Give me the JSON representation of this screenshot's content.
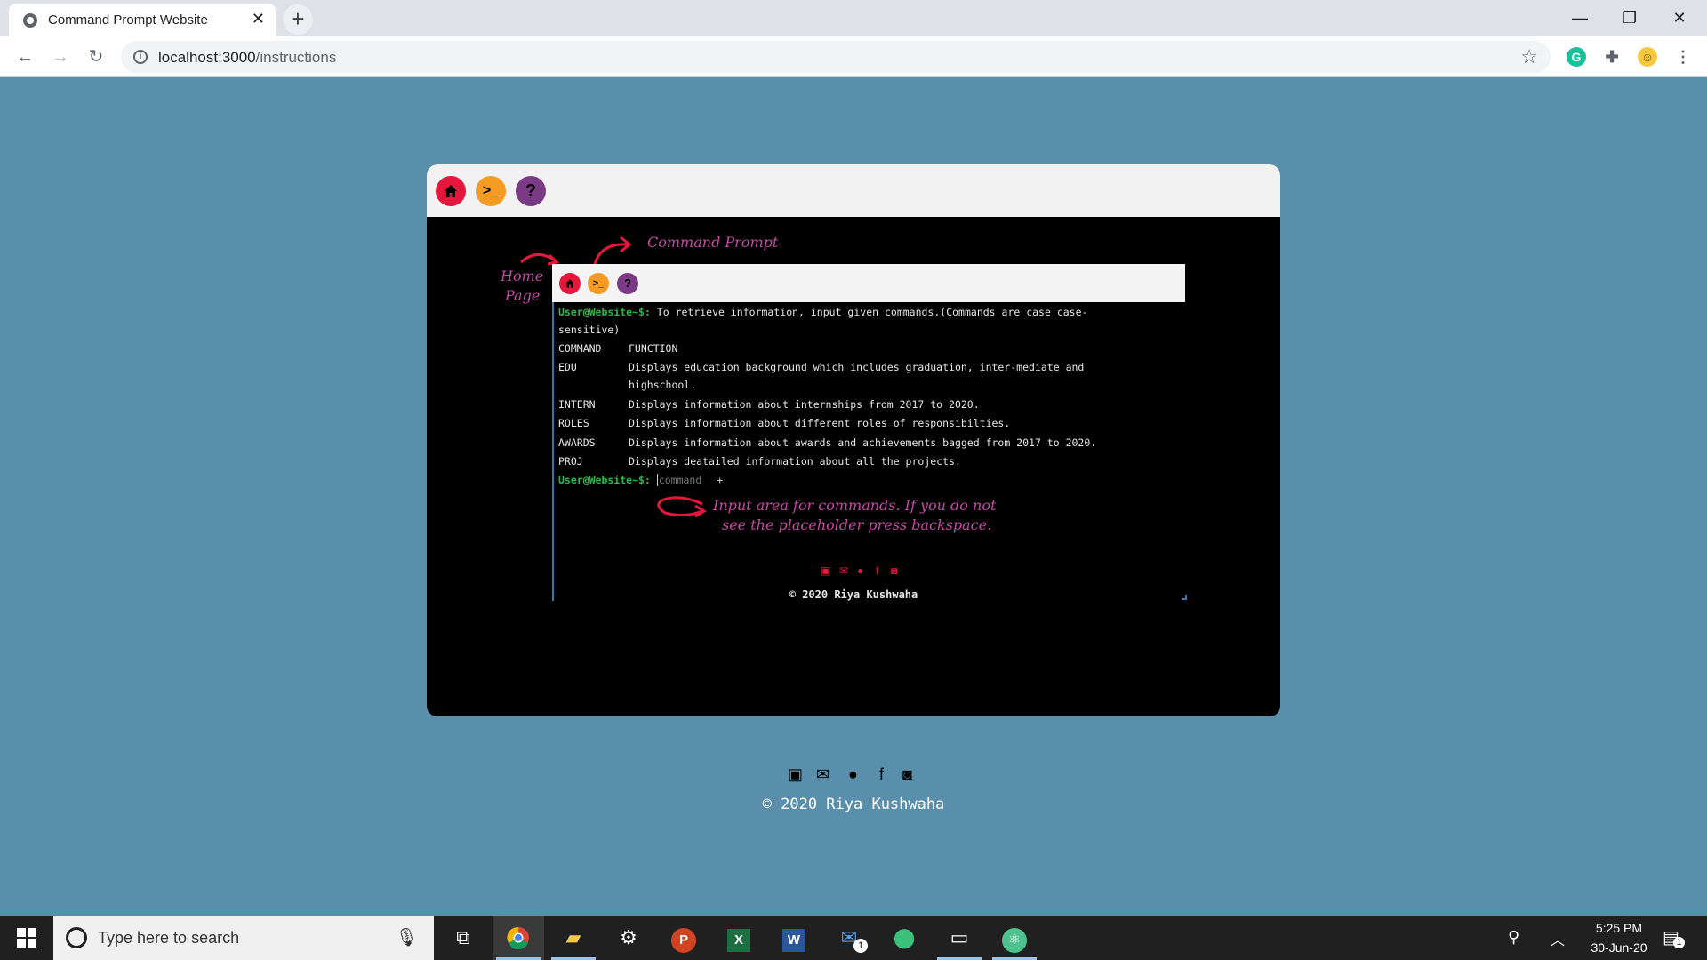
{
  "browser": {
    "tab_title": "Command Prompt Website",
    "url_host": "localhost:3000",
    "url_path": "/instructions",
    "accent": "#5a8fab"
  },
  "app": {
    "header_buttons": [
      {
        "icon": "home-icon",
        "glyph": "⌂",
        "color": "#e6173c"
      },
      {
        "icon": "terminal-icon",
        "glyph": ">_",
        "color": "#f59b23"
      },
      {
        "icon": "help-icon",
        "glyph": "?",
        "color": "#7a3a86"
      }
    ],
    "annotations": {
      "home_line1": "Home",
      "home_line2": "Page",
      "command_prompt": "Command Prompt",
      "input_line1": "Input area for commands. If you do not",
      "input_line2": "see the placeholder press backspace."
    },
    "terminal": {
      "prompt": "User@Website~$:",
      "intro_1": "To retrieve information, input given commands.(Commands are case case-",
      "intro_2": "sensitive)",
      "header_command": "COMMAND",
      "header_function": "FUNCTION",
      "commands": [
        {
          "cmd": "EDU",
          "desc": "Displays education background which includes graduation, inter-mediate and",
          "desc2": "highschool."
        },
        {
          "cmd": "INTERN",
          "desc": "Displays information about internships from 2017 to 2020."
        },
        {
          "cmd": "ROLES",
          "desc": "Displays information about different roles of responsibilties."
        },
        {
          "cmd": "AWARDS",
          "desc": "Displays information about awards and achievements bagged from 2017 to 2020."
        },
        {
          "cmd": "PROJ",
          "desc": "Displays deatailed information about all the projects."
        }
      ],
      "input_placeholder": "command"
    },
    "copyright": "© 2020 Riya Kushwaha"
  },
  "page": {
    "copyright": "© 2020 Riya Kushwaha",
    "socials": [
      "linkedin-icon",
      "mail-icon",
      "github-icon",
      "facebook-icon",
      "instagram-icon"
    ]
  },
  "taskbar": {
    "search_placeholder": "Type here to search",
    "time": "5:25 PM",
    "date": "30-Jun-20",
    "notification_count": "1",
    "mail_badge": "1"
  }
}
